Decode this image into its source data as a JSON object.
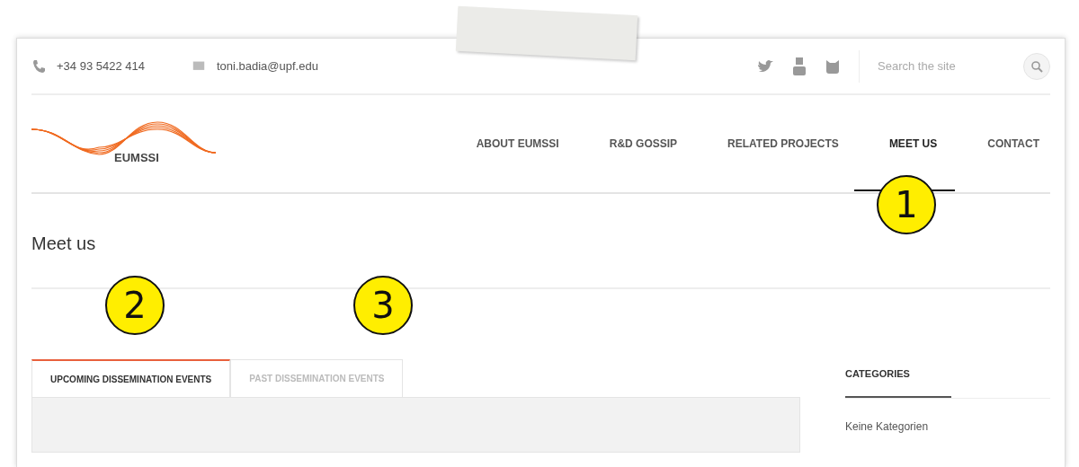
{
  "topbar": {
    "phone": "+34 93 5422 414",
    "email": "toni.badia@upf.edu",
    "search": {
      "placeholder": "Search the site"
    }
  },
  "logo": {
    "text": "EUMSSI"
  },
  "nav": [
    {
      "label": "ABOUT EUMSSI",
      "selected": false
    },
    {
      "label": "R&D GOSSIP",
      "selected": false
    },
    {
      "label": "RELATED PROJECTS",
      "selected": false
    },
    {
      "label": "MEET US",
      "selected": true
    },
    {
      "label": "CONTACT",
      "selected": false
    }
  ],
  "page_title": "Meet us",
  "tabs": [
    {
      "label": "UPCOMING DISSEMINATION EVENTS",
      "selected": true
    },
    {
      "label": "PAST DISSEMINATION EVENTS",
      "selected": false
    }
  ],
  "sidebar": {
    "heading": "CATEGORIES",
    "text": "Keine Kategorien"
  },
  "callouts": [
    "1",
    "2",
    "3"
  ]
}
